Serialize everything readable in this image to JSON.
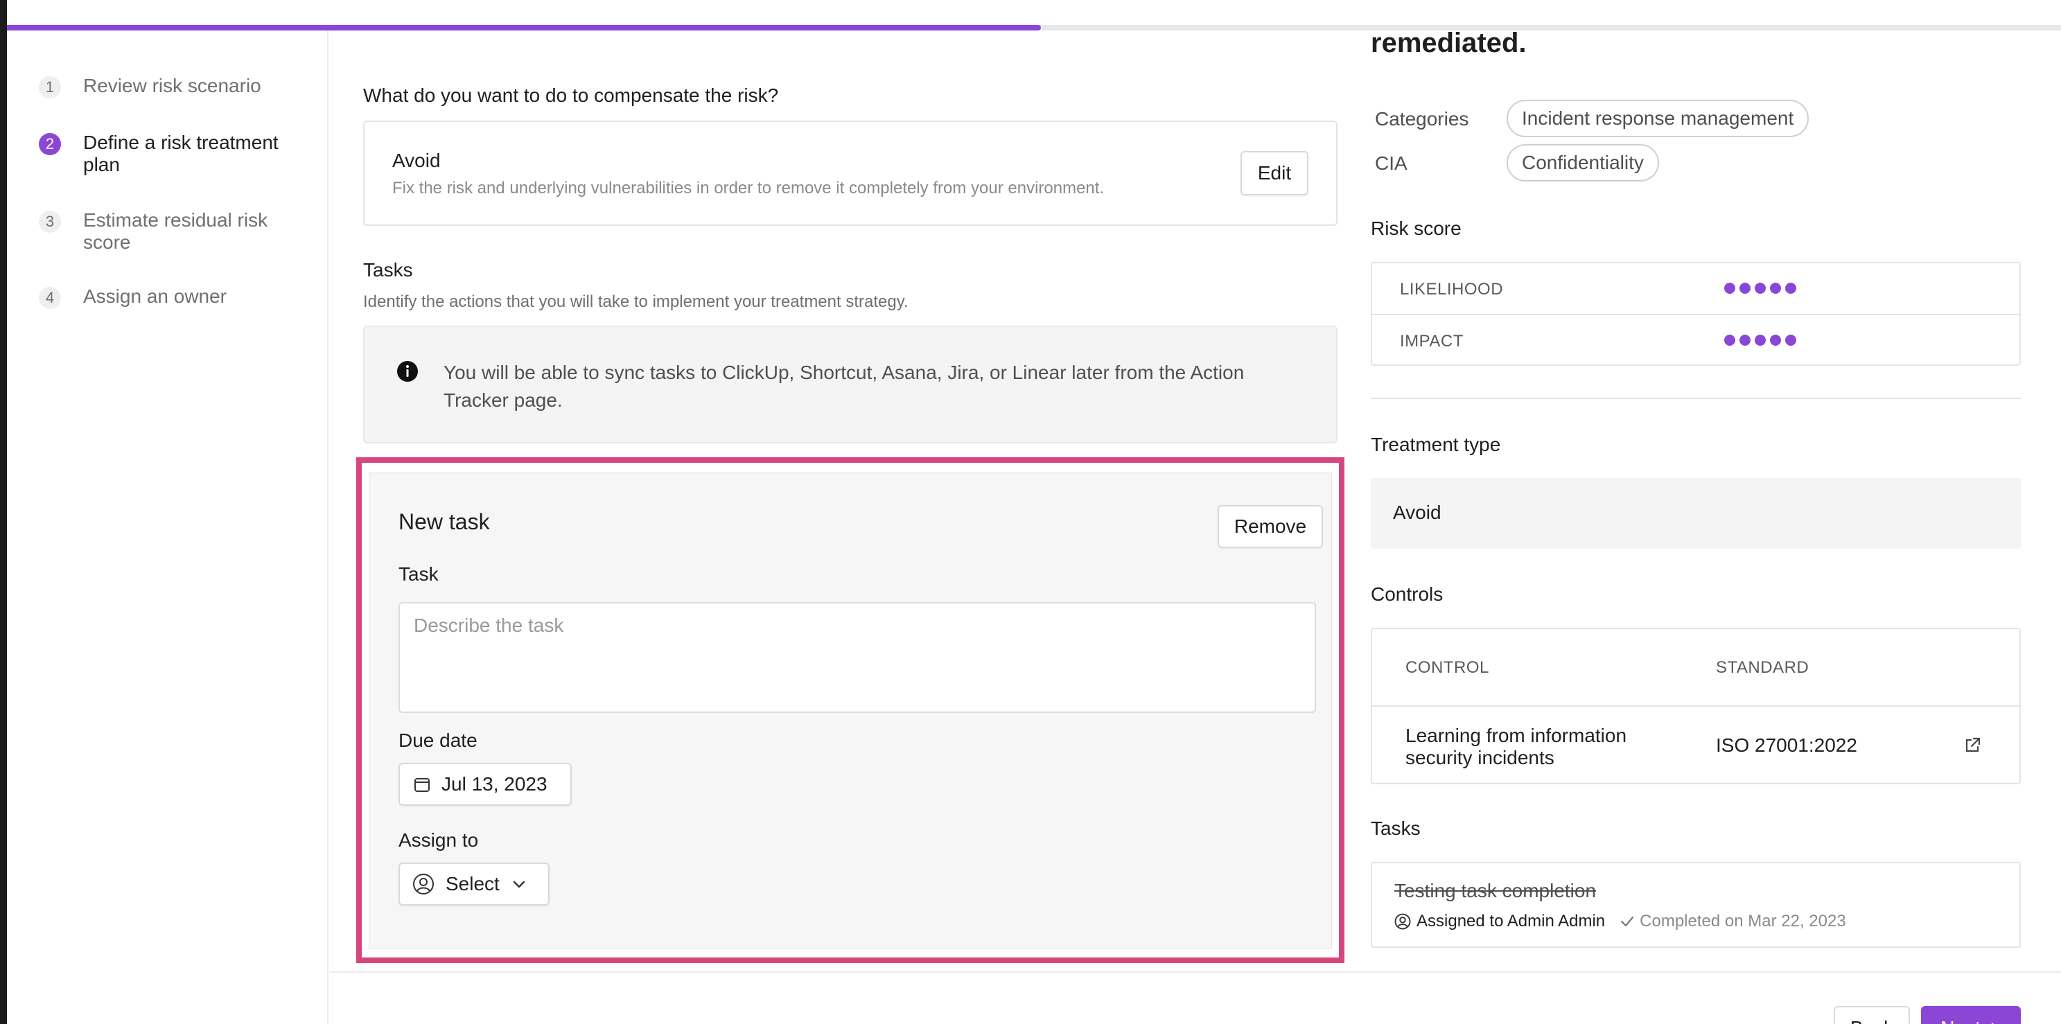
{
  "stepper": {
    "steps": [
      {
        "number": "1",
        "label": "Review risk scenario",
        "active": false
      },
      {
        "number": "2",
        "label": "Define a risk treatment plan",
        "active": true
      },
      {
        "number": "3",
        "label": "Estimate residual risk score",
        "active": false
      },
      {
        "number": "4",
        "label": "Assign an owner",
        "active": false
      }
    ]
  },
  "progress": {
    "fraction": 0.5
  },
  "main": {
    "question": "What do you want to do to compensate the risk?",
    "treatment": {
      "title": "Avoid",
      "description": "Fix the risk and underlying vulnerabilities in order to remove it completely from your environment.",
      "edit_label": "Edit"
    },
    "tasks": {
      "title": "Tasks",
      "description": "Identify the actions that you will take to implement your treatment strategy.",
      "info": "You will be able to sync tasks to ClickUp, Shortcut, Asana, Jira, or Linear later from the Action Tracker page."
    },
    "new_task": {
      "title": "New task",
      "remove_label": "Remove",
      "task_label": "Task",
      "task_placeholder": "Describe the task",
      "due_date_label": "Due date",
      "due_date_value": "Jul 13, 2023",
      "assign_label": "Assign to",
      "assign_value": "Select"
    }
  },
  "right": {
    "heading": "remediated.",
    "categories_label": "Categories",
    "categories_value": "Incident response management",
    "cia_label": "CIA",
    "cia_value": "Confidentiality",
    "risk_score_title": "Risk score",
    "likelihood_label": "LIKELIHOOD",
    "likelihood_dots": 5,
    "impact_label": "IMPACT",
    "impact_dots": 5,
    "treatment_type_title": "Treatment type",
    "treatment_type_value": "Avoid",
    "controls_title": "Controls",
    "controls": {
      "col_control": "CONTROL",
      "col_standard": "STANDARD",
      "rows": [
        {
          "control": "Learning from information security incidents",
          "standard": "ISO 27001:2022"
        }
      ]
    },
    "tasks_title": "Tasks",
    "task_item": {
      "title": "Testing task completion",
      "assigned": "Assigned to Admin Admin",
      "completed": "Completed on Mar 22, 2023"
    }
  },
  "footer": {
    "back_label": "Back",
    "next_label": "Next"
  },
  "colors": {
    "accent": "#8b46d6",
    "highlight_border": "#d6467d"
  }
}
